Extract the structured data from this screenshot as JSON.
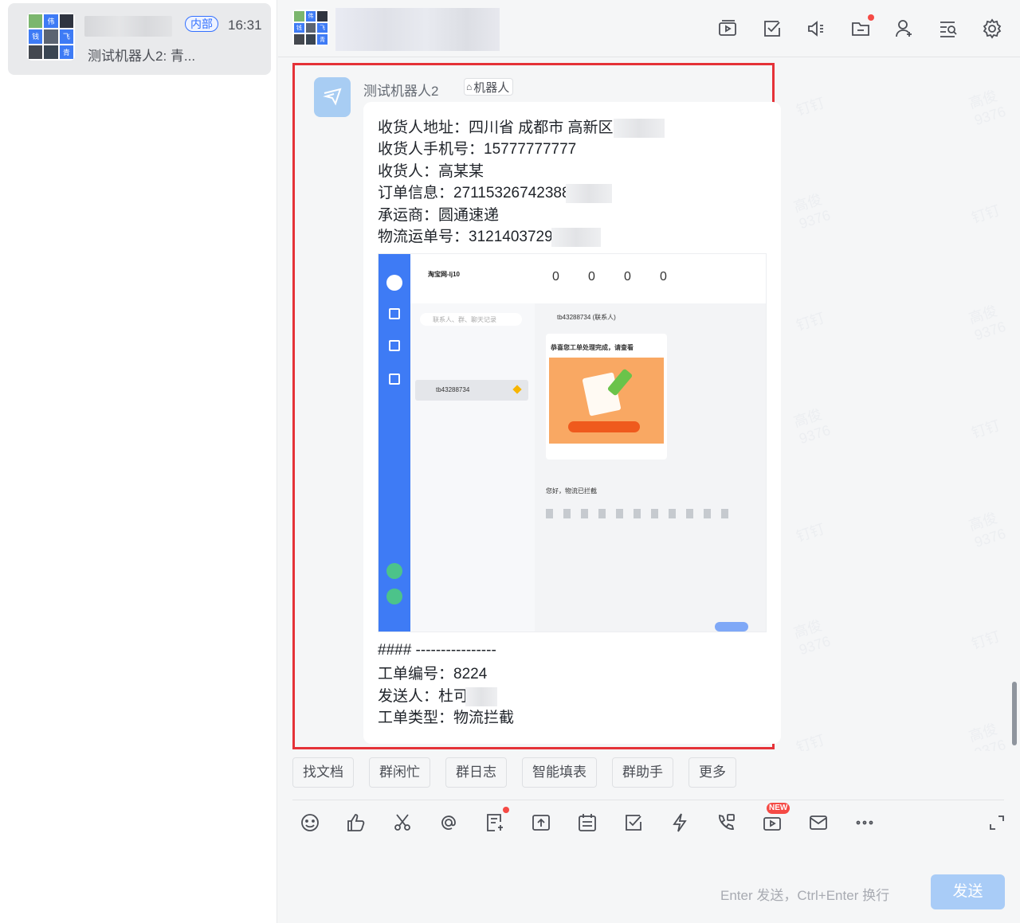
{
  "conversation": {
    "tag": "内部",
    "time": "16:31",
    "preview": "测试机器人2: 青..."
  },
  "avatar_cells": [
    {
      "bg": "#7bb66e",
      "txt": ""
    },
    {
      "bg": "#3e7bf5",
      "txt": "伟"
    },
    {
      "bg": "#2f3440",
      "txt": ""
    },
    {
      "bg": "#3e7bf5",
      "txt": "钱"
    },
    {
      "bg": "#5b6472",
      "txt": ""
    },
    {
      "bg": "#3e7bf5",
      "txt": "飞"
    },
    {
      "bg": "#44484f",
      "txt": ""
    },
    {
      "bg": "#3a4552",
      "txt": ""
    },
    {
      "bg": "#3e7bf5",
      "txt": "青"
    }
  ],
  "message": {
    "sender": "测试机器人2",
    "robot_tag": "机器人",
    "lines": {
      "address": "收货人地址：四川省 成都市 高新区",
      "phone": "收货人手机号：15777777777",
      "name": "收货人：高某某",
      "order": "订单信息：27115326742388",
      "carrier": "承运商：圆通速递",
      "tracking": "物流运单号：31214037299",
      "divider": "#### ----------------",
      "ticket_no": "工单编号：8224",
      "sender_line": "发送人：杜可",
      "ticket_type": "工单类型：物流拦截"
    },
    "screenshot": {
      "shop": "淘宝网-lj10",
      "counts": [
        "0",
        "0",
        "0",
        "0"
      ],
      "search_placeholder": "联系人、群、聊天记录",
      "customer": "tb43288734",
      "chat_title": "tb43288734 (联系人)",
      "card_title": "恭喜您工单处理完成，请查看",
      "reply": "您好，物流已拦截"
    }
  },
  "quick_actions": [
    "找文档",
    "群闲忙",
    "群日志",
    "智能填表",
    "群助手",
    "更多"
  ],
  "toolbar": {
    "new_badge": "NEW",
    "hint": "Enter 发送，Ctrl+Enter 换行",
    "send": "发送"
  },
  "watermark": [
    "高俊\n9376",
    "钉钉"
  ]
}
